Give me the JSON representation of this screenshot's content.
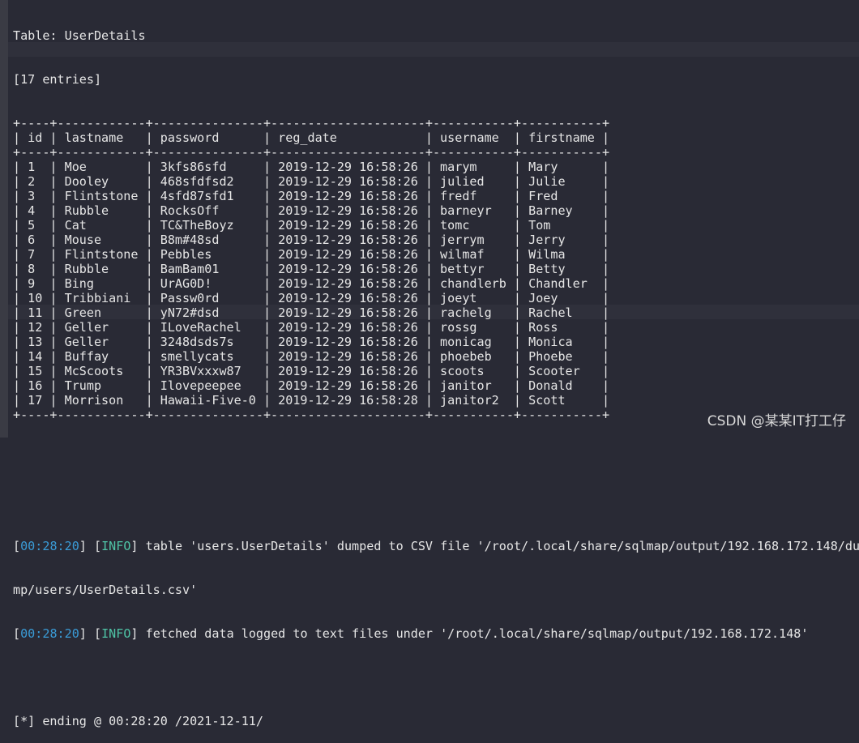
{
  "table_title": "Table: UserDetails",
  "entries": "[17 entries]",
  "columns": [
    "id",
    "lastname",
    "password",
    "reg_date",
    "username",
    "firstname"
  ],
  "rows": [
    [
      "1",
      "Moe",
      "3kfs86sfd",
      "2019-12-29 16:58:26",
      "marym",
      "Mary"
    ],
    [
      "2",
      "Dooley",
      "468sfdfsd2",
      "2019-12-29 16:58:26",
      "julied",
      "Julie"
    ],
    [
      "3",
      "Flintstone",
      "4sfd87sfd1",
      "2019-12-29 16:58:26",
      "fredf",
      "Fred"
    ],
    [
      "4",
      "Rubble",
      "RocksOff",
      "2019-12-29 16:58:26",
      "barneyr",
      "Barney"
    ],
    [
      "5",
      "Cat",
      "TC&TheBoyz",
      "2019-12-29 16:58:26",
      "tomc",
      "Tom"
    ],
    [
      "6",
      "Mouse",
      "B8m#48sd",
      "2019-12-29 16:58:26",
      "jerrym",
      "Jerry"
    ],
    [
      "7",
      "Flintstone",
      "Pebbles",
      "2019-12-29 16:58:26",
      "wilmaf",
      "Wilma"
    ],
    [
      "8",
      "Rubble",
      "BamBam01",
      "2019-12-29 16:58:26",
      "bettyr",
      "Betty"
    ],
    [
      "9",
      "Bing",
      "UrAG0D!",
      "2019-12-29 16:58:26",
      "chandlerb",
      "Chandler"
    ],
    [
      "10",
      "Tribbiani",
      "Passw0rd",
      "2019-12-29 16:58:26",
      "joeyt",
      "Joey"
    ],
    [
      "11",
      "Green",
      "yN72#dsd",
      "2019-12-29 16:58:26",
      "rachelg",
      "Rachel"
    ],
    [
      "12",
      "Geller",
      "ILoveRachel",
      "2019-12-29 16:58:26",
      "rossg",
      "Ross"
    ],
    [
      "13",
      "Geller",
      "3248dsds7s",
      "2019-12-29 16:58:26",
      "monicag",
      "Monica"
    ],
    [
      "14",
      "Buffay",
      "smellycats",
      "2019-12-29 16:58:26",
      "phoebeb",
      "Phoebe"
    ],
    [
      "15",
      "McScoots",
      "YR3BVxxxw87",
      "2019-12-29 16:58:26",
      "scoots",
      "Scooter"
    ],
    [
      "16",
      "Trump",
      "Ilovepeepee",
      "2019-12-29 16:58:26",
      "janitor",
      "Donald"
    ],
    [
      "17",
      "Morrison",
      "Hawaii-Five-0",
      "2019-12-29 16:58:28",
      "janitor2",
      "Scott"
    ]
  ],
  "logs": [
    {
      "time": "00:28:20",
      "level": "INFO",
      "message": "table 'users.UserDetails' dumped to CSV file '/root/.local/share/sqlmap/output/192.168.172.148/du"
    },
    {
      "continuation": "mp/users/UserDetails.csv'"
    },
    {
      "time": "00:28:20",
      "level": "INFO",
      "message": "fetched data logged to text files under '/root/.local/share/sqlmap/output/192.168.172.148'"
    }
  ],
  "ending": "[*] ending @ 00:28:20 /2021-12-11/",
  "watermark": "CSDN @某某IT打工仔",
  "colors": {
    "background": "#292a35",
    "timestamp": "#3a9bd6",
    "info": "#4fc4a6",
    "text": "#e6e6e6"
  }
}
